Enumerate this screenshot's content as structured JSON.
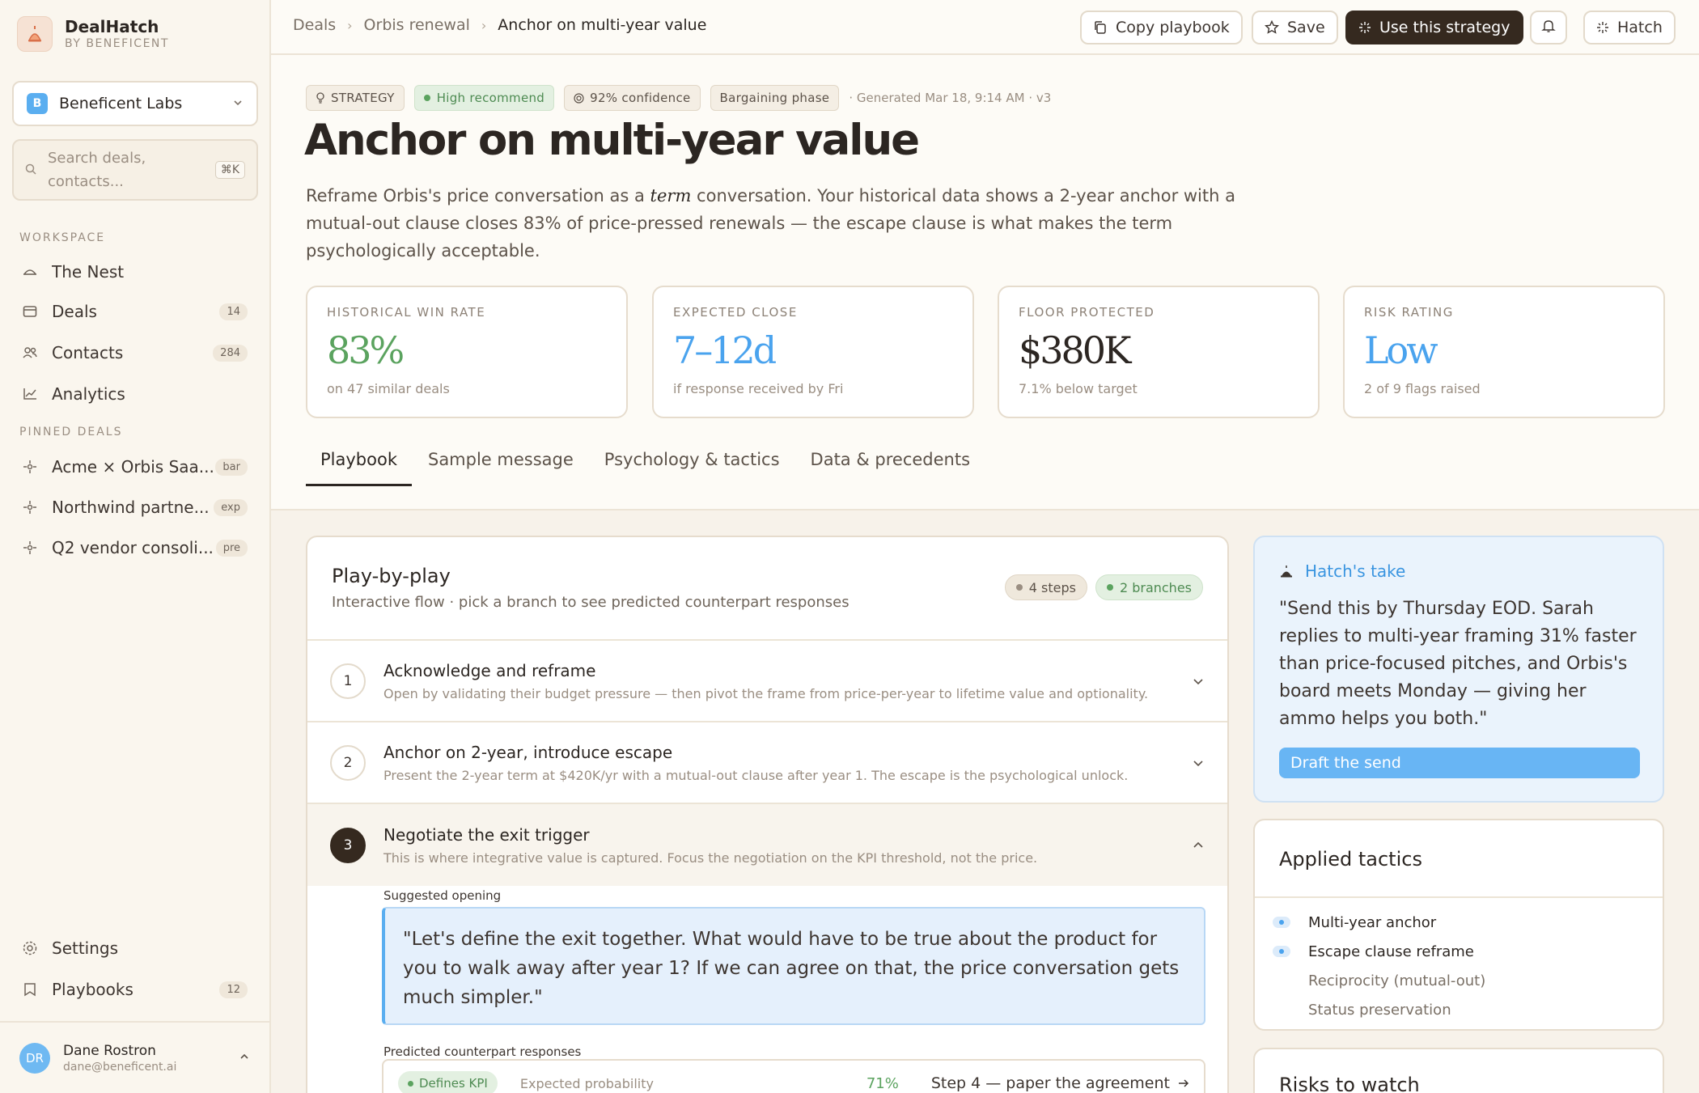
{
  "brand": {
    "name": "DealHatch",
    "sub": "BY BENEFICENT"
  },
  "org": {
    "badge": "B",
    "name": "Beneficent Labs"
  },
  "search": {
    "placeholder": "Search deals, contacts...",
    "shortcut": "⌘K"
  },
  "sidebar": {
    "workspace_label": "WORKSPACE",
    "workspace": [
      {
        "label": "The Nest",
        "icon": "nest-icon",
        "count": ""
      },
      {
        "label": "Deals",
        "icon": "deals-icon",
        "count": "14"
      },
      {
        "label": "Contacts",
        "icon": "contacts-icon",
        "count": "284"
      },
      {
        "label": "Analytics",
        "icon": "analytics-icon",
        "count": ""
      }
    ],
    "pinned_label": "PINNED DEALS",
    "pinned": [
      {
        "label": "Acme × Orbis Saa...",
        "tag": "bar"
      },
      {
        "label": "Northwind partne...",
        "tag": "exp"
      },
      {
        "label": "Q2 vendor consoli...",
        "tag": "pre"
      }
    ],
    "settings": "Settings",
    "playbooks": "Playbooks",
    "playbooks_count": "12"
  },
  "user": {
    "initials": "DR",
    "name": "Dane Rostron",
    "email": "dane@beneficent.ai"
  },
  "breadcrumbs": [
    "Deals",
    "Orbis renewal",
    "Anchor on multi-year value"
  ],
  "toolbar": {
    "copy": "Copy playbook",
    "save": "Save",
    "use": "Use this strategy",
    "hatch": "Hatch"
  },
  "header": {
    "chips": {
      "strategy": "STRATEGY",
      "recommend": "High recommend",
      "confidence": "92% confidence",
      "phase": "Bargaining phase"
    },
    "generated": "· Generated Mar 18, 9:14 AM · v3",
    "title": "Anchor on multi-year value",
    "desc_pre": "Reframe Orbis's price conversation as a ",
    "desc_em": "term",
    "desc_post": " conversation. Your historical data shows a 2-year anchor with a mutual-out clause closes 83% of price-pressed renewals — the escape clause is what makes the term psychologically acceptable."
  },
  "metrics": [
    {
      "label": "HISTORICAL WIN RATE",
      "value": "83%",
      "sub": "on 47 similar deals",
      "color": "#5ba35f"
    },
    {
      "label": "EXPECTED CLOSE",
      "value": "7–12d",
      "sub": "if response received by Fri",
      "color": "#4aa3ee"
    },
    {
      "label": "FLOOR PROTECTED",
      "value": "$380K",
      "sub": "7.1% below target",
      "color": "#2c2622"
    },
    {
      "label": "RISK RATING",
      "value": "Low",
      "sub": "2 of 9 flags raised",
      "color": "#4aa3ee"
    }
  ],
  "tabs": [
    "Playbook",
    "Sample message",
    "Psychology & tactics",
    "Data & precedents"
  ],
  "playbook": {
    "title": "Play-by-play",
    "sub": "Interactive flow · pick a branch to see predicted counterpart responses",
    "steps_pill": "4 steps",
    "branches_pill": "2 branches",
    "steps": [
      {
        "num": "1",
        "title": "Acknowledge and reframe",
        "desc": "Open by validating their budget pressure — then pivot the frame from price-per-year to lifetime value and optionality."
      },
      {
        "num": "2",
        "title": "Anchor on 2-year, introduce escape",
        "desc": "Present the 2-year term at $420K/yr with a mutual-out clause after year 1. The escape is the psychological unlock."
      },
      {
        "num": "3",
        "title": "Negotiate the exit trigger",
        "desc": "This is where integrative value is captured. Focus the negotiation on the KPI threshold, not the price."
      }
    ],
    "opening_label": "Suggested opening",
    "opening": "\"Let's define the exit together. What would have to be true about the product for you to walk away after year 1? If we can agree on that, the price conversation gets much simpler.\"",
    "pred_label": "Predicted counterpart responses",
    "pred": {
      "tag": "Defines KPI",
      "prob_label": "Expected probability",
      "pct": "71%",
      "next": "Step 4 — paper the agreement"
    }
  },
  "take": {
    "title": "Hatch's take",
    "text": "\"Send this by Thursday EOD. Sarah replies to multi-year framing 31% faster than price-focused pitches, and Orbis's board meets Monday — giving her ammo helps you both.\"",
    "button": "Draft the send"
  },
  "tactics": {
    "title": "Applied tactics",
    "active": [
      "Multi-year anchor",
      "Escape clause reframe"
    ],
    "muted": [
      "Reciprocity (mutual-out)",
      "Status preservation"
    ]
  },
  "risks": {
    "title": "Risks to watch"
  }
}
